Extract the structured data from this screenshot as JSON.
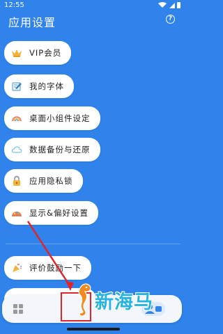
{
  "status_bar": {
    "time": "12:55"
  },
  "header": {
    "title": "应用设置",
    "help_icon": "help-circle-icon"
  },
  "menu": [
    {
      "label": "VIP会员",
      "icon": "crown-icon",
      "color": "#f2b43c"
    },
    {
      "label": "我的字体",
      "icon": "font-edit-icon",
      "color": "#6aa7d8"
    },
    {
      "label": "桌面小组件设定",
      "icon": "rainbow-icon",
      "color": "#e9766c"
    },
    {
      "label": "数据备份与还原",
      "icon": "cloud-icon",
      "color": "#7cc6e8"
    },
    {
      "label": "应用隐私锁",
      "icon": "lock-icon",
      "color": "#f2b43c"
    },
    {
      "label": "显示&偏好设置",
      "icon": "palette-icon",
      "color": "#e47f55"
    },
    {
      "label": "评价鼓励一下",
      "icon": "party-popper-icon",
      "color": "#f2b43c"
    }
  ],
  "tab_bar": {
    "left_icon": "grid-icon",
    "right_icon": "person-icon",
    "accent": "#2f83ea"
  },
  "watermark": {
    "text": "新海马"
  },
  "colors": {
    "background": "#2f83ea",
    "card": "#ffffff",
    "annotation": "#e0242b"
  }
}
